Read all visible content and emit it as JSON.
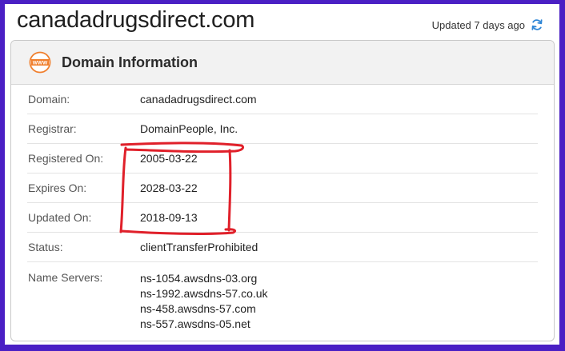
{
  "header": {
    "site_title": "canadadrugsdirect.com",
    "updated_text": "Updated 7 days ago",
    "refresh_icon": "refresh-icon"
  },
  "card": {
    "icon": "www-icon",
    "icon_text": "WWW",
    "title": "Domain Information",
    "rows": [
      {
        "label": "Domain:",
        "value": "canadadrugsdirect.com"
      },
      {
        "label": "Registrar:",
        "value": "DomainPeople, Inc."
      },
      {
        "label": "Registered On:",
        "value": "2005-03-22"
      },
      {
        "label": "Expires On:",
        "value": "2028-03-22"
      },
      {
        "label": "Updated On:",
        "value": "2018-09-13"
      },
      {
        "label": "Status:",
        "value": "clientTransferProhibited"
      }
    ],
    "name_servers": {
      "label": "Name Servers:",
      "values": [
        "ns-1054.awsdns-03.org",
        "ns-1992.awsdns-57.co.uk",
        "ns-458.awsdns-57.com",
        "ns-557.awsdns-05.net"
      ]
    }
  },
  "colors": {
    "frame": "#4a1fc4",
    "accent_icon": "#f07f2d",
    "refresh": "#2f86d6",
    "annotation": "#e0202a"
  }
}
